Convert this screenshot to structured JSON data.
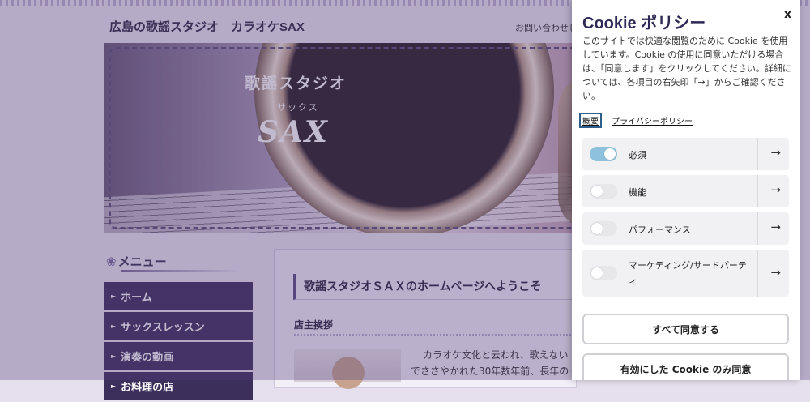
{
  "site": {
    "title": "広島の歌謡スタジオ　カラオケSAX",
    "contact": "お問い合わせし",
    "hero": {
      "line1": "歌謡スタジオ",
      "line2": "サックス",
      "line3": "SAX"
    },
    "menu_heading": "メニュー",
    "menu_items": [
      "ホーム",
      "サックスレッスン",
      "演奏の動画",
      "お料理の店"
    ],
    "welcome": "歌謡スタジオＳＡＸのホームページへようこそ",
    "greeting_title": "店主挨拶",
    "para1": "カラオケ文化と云われ、歌えない",
    "para2": "でささやかれた30年数年前、長年の"
  },
  "cookie": {
    "title": "Cookie ポリシー",
    "close": "x",
    "description": "このサイトでは快適な閲覧のために Cookie を使用しています。Cookie の使用に同意いただける場合は、「同意します」をクリックしてください。詳細については、各項目の右矢印「→」からご確認ください。",
    "tab_overview": "概要",
    "privacy_link": "プライバシーポリシー",
    "categories": [
      {
        "label": "必須",
        "enabled": true
      },
      {
        "label": "機能",
        "enabled": false
      },
      {
        "label": "パフォーマンス",
        "enabled": false
      },
      {
        "label": "マーケティング/サードパーティ",
        "enabled": false
      }
    ],
    "arrow": "→",
    "accept_all": "すべて同意する",
    "accept_selected": "有効にした Cookie のみ同意"
  }
}
